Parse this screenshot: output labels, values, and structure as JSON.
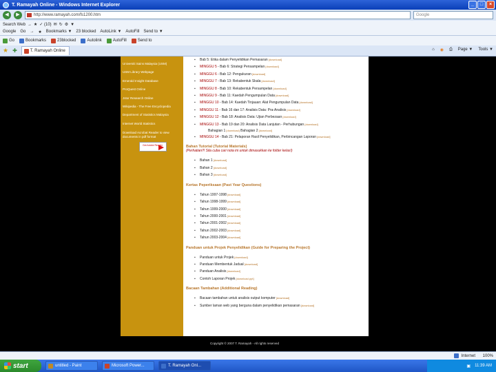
{
  "window": {
    "title": "T. Ramayah Online - Windows Internet Explorer"
  },
  "address": {
    "url": "http://www.ramayah.com/fs1200.htm",
    "search_placeholder": "Google"
  },
  "menubar": {
    "items": [
      "Search Web",
      "→",
      "★",
      "✓ (10)",
      "✉",
      "↻",
      "⚙",
      "▼"
    ]
  },
  "googlebar": {
    "label": "Google",
    "items": [
      "Go",
      "→",
      "★",
      "Bookmarks ▼",
      "23 blocked",
      "AutoLink ▼",
      "AutoFill",
      "Send to ▼"
    ]
  },
  "linksbar": {
    "items": [
      "Go",
      "Bookmarks",
      "23blocked",
      "Autolink",
      "AutoFill",
      "Send to"
    ]
  },
  "tabs": {
    "active_tab": "T. Ramayah Online"
  },
  "commandbar": {
    "items": [
      "Page ▼",
      "Tools ▼"
    ]
  },
  "sidebar": {
    "links": [
      "Universiti Sains Malaysia (USM)",
      "USM Library Webpage",
      "Emerald Insight Database",
      "ProQuest Online",
      "Jstor Research Online",
      "Wikipedia - The Free Encyclopedia",
      "Department of Statistics Malaysia",
      "Internet World Statistics"
    ],
    "acrobat_text": "Download Acrobat Reader to view documents in pdf format",
    "acrobat_badge": "Get Adobe Reader"
  },
  "content": {
    "download_label": "[download]",
    "minggu_items": [
      {
        "prefix": "",
        "text": "Bab 5: Etika dalam Penyelidikan Pemasaran"
      },
      {
        "prefix": "MINGGU 5",
        "text": " - Bab 6: Strategi Pensampelan"
      },
      {
        "prefix": "MINGGU 6",
        "text": " - Bab 12: Pengukuran"
      },
      {
        "prefix": "MINGGU 7",
        "text": " - Bab 13: Rekabentuk Skala"
      },
      {
        "prefix": "MINGGU 8",
        "text": " - Bab 10: Rekabentuk Persampelan"
      },
      {
        "prefix": "MINGGU 9",
        "text": " - Bab 11: Kaedah Pengumpulan Data"
      },
      {
        "prefix": "MINGGU 10",
        "text": " - Bab 14: Kaedah Tinjauan: Alat Pengumpulan Data"
      },
      {
        "prefix": "MINGGU 11",
        "text": " - Bab 16 dan 17: Analisis Data: Pra-Analisis"
      },
      {
        "prefix": "MINGGU 12",
        "text": " - Bab 18: Analisis Data: Ujian Perbezaan"
      },
      {
        "prefix": "MINGGU 13",
        "text": " - Bab 19 dan 20: Analisis Data Lanjutan - Perhubungan"
      },
      {
        "prefix": "MINGGU 14",
        "text": " - Bab 21: Pelaporan Hasil Penyelidikan, Perbincangan Laporan"
      }
    ],
    "minggu13_cont": [
      "Bahagian 1",
      "Bahagian 2"
    ],
    "tutorial_title": "Bahan Tutorial (Tutorial Materials)",
    "tutorial_sub": "(Perhatian!!! Sila cuba cari nota ini untuk dimasukkan ke folder kelas!)",
    "tutorial_items": [
      "Bahan 1",
      "Bahan 2",
      "Bahan 3"
    ],
    "exam_title": "Kertas Peperiksaan (Past Year Questions)",
    "exam_items": [
      "Tahun 1997-1998",
      "Tahun 1998-1999",
      "Tahun 1999-2000",
      "Tahun 2000-2001",
      "Tahun 2001-2002",
      "Tahun 2002-2003",
      "Tahun 2003-2004"
    ],
    "project_title": "Panduan untuk Projek Penyelidikan (Guide for Preparing the Project)",
    "project_items": [
      "Panduan untuk Projek",
      "Panduan Membentuk Jadual",
      "Panduan Analisis",
      "Contoh Laporan Projek"
    ],
    "project_last_label": "[download.ppt]",
    "extra_title": "Bacaan Tambahan (Additional Reading)",
    "extra_items": [
      "Bacaan tambahan untuk analisis output komputer",
      "Sumber laman web yang berguna dalam penyelidikan pemasaran"
    ],
    "footer": "Copyright © 2007 T. Ramayah - All rights reserved"
  },
  "statusbar": {
    "zone": "Internet",
    "zoom": "100%"
  },
  "taskbar": {
    "start": "start",
    "buttons": [
      "untitled - Paint",
      "Microsoft Power...",
      "T. Ramayah Onl..."
    ],
    "tray_time": "11:39 AM",
    "tray_label": "Internet"
  }
}
